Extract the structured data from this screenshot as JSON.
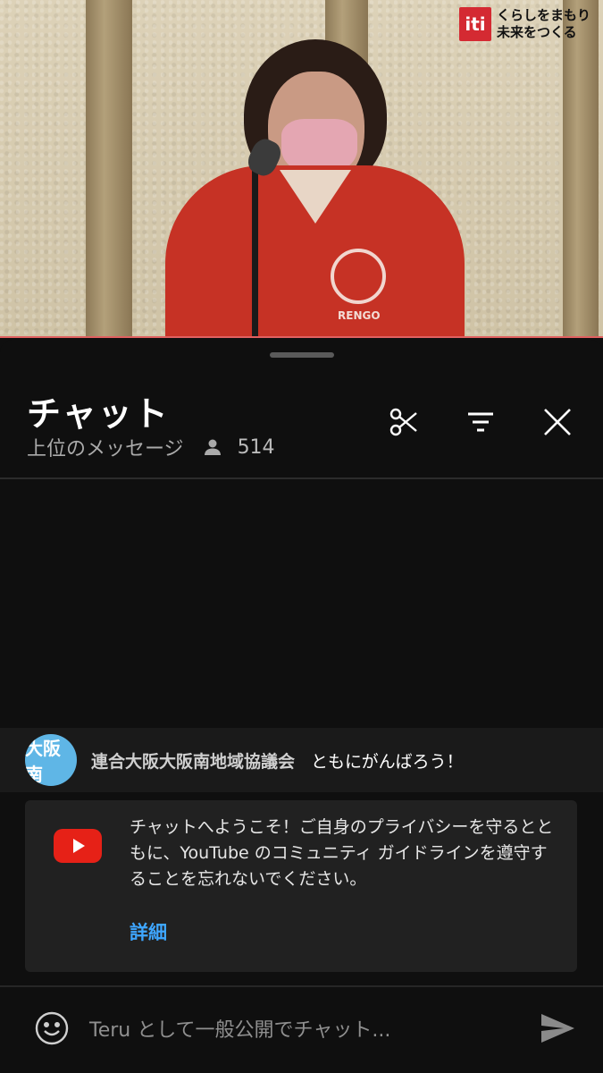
{
  "video": {
    "logo_mark": "iti",
    "logo_line1": "くらしをまもり",
    "logo_line2": "未来をつくる",
    "jacket_text": "RENGO"
  },
  "chat": {
    "title": "チャット",
    "mode_label": "上位のメッセージ",
    "viewer_count": "514",
    "icons": [
      "scissors-icon",
      "filter-icon",
      "close-icon"
    ]
  },
  "pinned": {
    "avatar_text": "大阪南",
    "author": "連合大阪大阪南地域協議会",
    "message": "ともにがんばろう！"
  },
  "welcome": {
    "text": "チャットへようこそ！ご自身のプライバシーを守るとともに、YouTube のコミュニティ ガイドラインを遵守することを忘れないでください。",
    "learn_more": "詳細"
  },
  "input": {
    "placeholder": "Teru として一般公開でチャット..."
  },
  "colors": {
    "background": "#0f0f0f",
    "link": "#3ea6ff",
    "youtube_red": "#e62117"
  }
}
